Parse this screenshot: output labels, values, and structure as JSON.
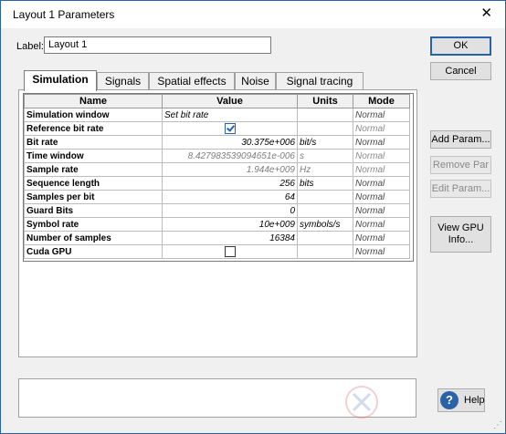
{
  "window": {
    "title": "Layout 1 Parameters",
    "close_glyph": "✕"
  },
  "label_field": {
    "label": "Label:",
    "value": "Layout 1"
  },
  "buttons": {
    "ok": "OK",
    "cancel": "Cancel",
    "add_param": "Add Param...",
    "remove_param": "Remove Par",
    "edit_param": "Edit Param...",
    "view_gpu": "View GPU Info...",
    "help": "Help",
    "help_icon": "?"
  },
  "tabs": [
    "Simulation",
    "Signals",
    "Spatial effects",
    "Noise",
    "Signal tracing"
  ],
  "active_tab": "Simulation",
  "table": {
    "headers": [
      "Name",
      "Value",
      "Units",
      "Mode"
    ],
    "rows": [
      {
        "name": "Simulation window",
        "value": "Set bit rate",
        "units": "",
        "mode": "Normal"
      },
      {
        "name": "Reference bit rate",
        "value": "",
        "checkbox": true,
        "checked": true,
        "units": "",
        "mode": "Normal"
      },
      {
        "name": "Bit rate",
        "value": "30.375e+006",
        "units": "bit/s",
        "mode": "Normal"
      },
      {
        "name": "Time window",
        "value": "8.427983539094651e-006",
        "units": "s",
        "mode": "Normal"
      },
      {
        "name": "Sample rate",
        "value": "1.944e+009",
        "units": "Hz",
        "mode": "Normal"
      },
      {
        "name": "Sequence length",
        "value": "256",
        "units": "bits",
        "mode": "Normal"
      },
      {
        "name": "Samples per bit",
        "value": "64",
        "units": "",
        "mode": "Normal"
      },
      {
        "name": "Guard Bits",
        "value": "0",
        "units": "",
        "mode": "Normal"
      },
      {
        "name": "Symbol rate",
        "value": "10e+009",
        "units": "symbols/s",
        "mode": "Normal"
      },
      {
        "name": "Number of samples",
        "value": "16384",
        "units": "",
        "mode": "Normal"
      },
      {
        "name": "Cuda GPU",
        "value": "",
        "checkbox": true,
        "checked": false,
        "units": "",
        "mode": "Normal"
      }
    ]
  },
  "colors": {
    "accent": "#2a62a8",
    "dialog_bg": "#f0f0f0",
    "grid_border": "#bdbdbd",
    "gray_text": "#7d7d7d"
  }
}
